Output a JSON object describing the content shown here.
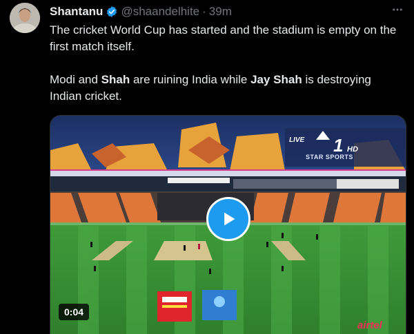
{
  "tweet": {
    "author_name": "Shantanu",
    "handle": "@shaandelhite",
    "separator": "·",
    "time": "39m",
    "paragraph1": "The cricket World Cup has started and the stadium is empty on the first match itself.",
    "paragraph2_parts": [
      "Modi and ",
      "Shah",
      " are ruining India while ",
      "Jay Shah",
      " is destroying Indian cricket."
    ]
  },
  "media": {
    "duration": "0:04",
    "overlay_live": "LIVE",
    "overlay_channel_number": "1",
    "overlay_channel_hd": "HD",
    "overlay_broadcaster": "STAR SPORTS",
    "sponsor_text": "airtel"
  },
  "icons": {
    "verified": "verified-badge-icon",
    "more": "more-icon",
    "play": "play-icon"
  },
  "colors": {
    "background": "#000000",
    "text": "#e7e9ea",
    "secondary_text": "#71767b",
    "accent": "#1d9bf0"
  }
}
